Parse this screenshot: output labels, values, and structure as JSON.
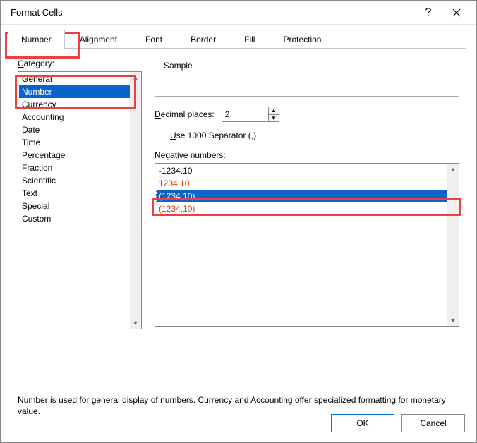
{
  "title": "Format Cells",
  "tabs": {
    "t0": "Number",
    "t1": "Alignment",
    "t2": "Font",
    "t3": "Border",
    "t4": "Fill",
    "t5": "Protection"
  },
  "category_label_pre": "C",
  "category_label_post": "ategory:",
  "categories": {
    "c0": "General",
    "c1": "Number",
    "c2": "Currency",
    "c3": "Accounting",
    "c4": "Date",
    "c5": "Time",
    "c6": "Percentage",
    "c7": "Fraction",
    "c8": "Scientific",
    "c9": "Text",
    "c10": "Special",
    "c11": "Custom"
  },
  "sample_label": "Sample",
  "decimal_pre": "D",
  "decimal_post": "ecimal places:",
  "decimal_value": "2",
  "separator_pre": "U",
  "separator_post": "se 1000 Separator (,)",
  "negative_pre": "N",
  "negative_post": "egative numbers:",
  "neg": {
    "n0": "-1234.10",
    "n1": "1234.10",
    "n2": "(1234.10)",
    "n3": "(1234.10)"
  },
  "note": "Number is used for general display of numbers.  Currency and Accounting offer specialized formatting for monetary value.",
  "ok": "OK",
  "cancel": "Cancel",
  "help": "?"
}
